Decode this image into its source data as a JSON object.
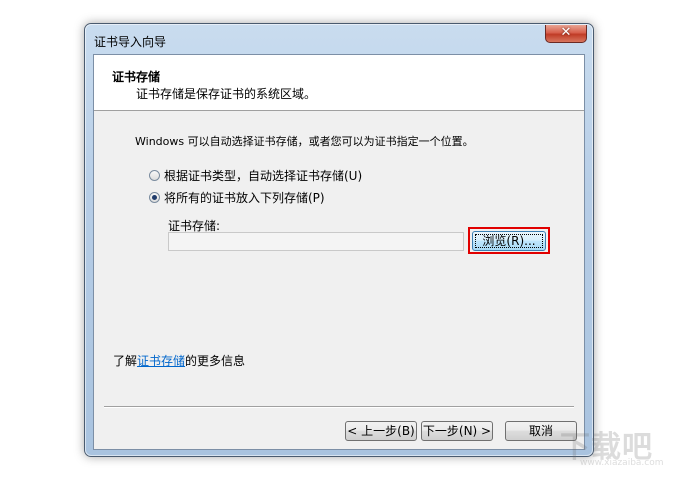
{
  "window": {
    "title": "证书导入向导",
    "close_glyph": "✕"
  },
  "header": {
    "title": "证书存储",
    "subtitle": "证书存储是保存证书的系统区域。"
  },
  "intro_text": "Windows 可以自动选择证书存储，或者您可以为证书指定一个位置。",
  "options": {
    "auto_label": "根据证书类型，自动选择证书存储(U)",
    "manual_label": "将所有的证书放入下列存储(P)",
    "selected": "manual"
  },
  "store": {
    "label": "证书存储:",
    "value": "",
    "browse_label": "浏览(R)..."
  },
  "learn_more": {
    "prefix": "了解",
    "link": "证书存储",
    "suffix": "的更多信息"
  },
  "buttons": {
    "back": "< 上一步(B)",
    "next": "下一步(N) >",
    "cancel": "取消"
  },
  "watermark": {
    "text": "下载吧",
    "url": "www.xiazaiba.com"
  },
  "colors": {
    "highlight": "#e10000",
    "link": "#0066cc",
    "close_button": "#c03b26"
  }
}
